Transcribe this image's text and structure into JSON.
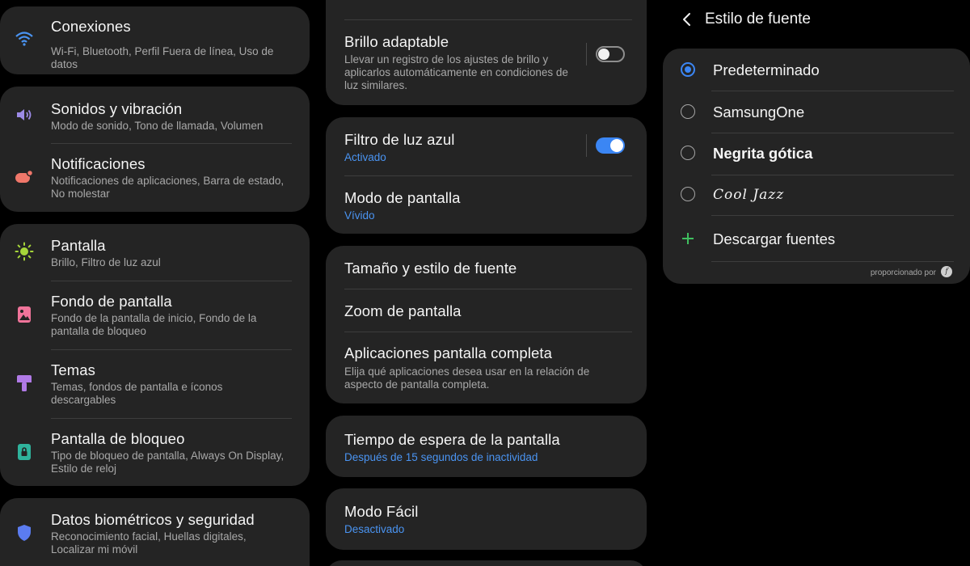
{
  "panel1": {
    "conexiones": {
      "title": "Conexiones",
      "subtitle": "Wi-Fi, Bluetooth, Perfil Fuera de línea, Uso de datos",
      "icon": "wifi-icon",
      "color": "#4a94f2"
    },
    "sonidos": {
      "title": "Sonidos y vibración",
      "subtitle": "Modo de sonido, Tono de llamada, Volumen",
      "icon": "volume-icon",
      "color": "#9c8ae6"
    },
    "notificaciones": {
      "title": "Notificaciones",
      "subtitle": "Notificaciones de aplicaciones, Barra de estado, No molestar",
      "icon": "notification-icon",
      "color": "#f0776a"
    },
    "pantalla": {
      "title": "Pantalla",
      "subtitle": "Brillo, Filtro de luz azul",
      "icon": "brightness-icon",
      "color": "#a6d63a"
    },
    "fondo": {
      "title": "Fondo de pantalla",
      "subtitle": "Fondo de la pantalla de inicio, Fondo de la pantalla de bloqueo",
      "icon": "wallpaper-icon",
      "color": "#f0749a"
    },
    "temas": {
      "title": "Temas",
      "subtitle": "Temas, fondos de pantalla e íconos descargables",
      "icon": "theme-brush-icon",
      "color": "#b07ae6"
    },
    "bloqueo": {
      "title": "Pantalla de bloqueo",
      "subtitle": "Tipo de bloqueo de pantalla, Always On Display, Estilo de reloj",
      "icon": "lock-icon",
      "color": "#2fb39c"
    },
    "biometricos": {
      "title": "Datos biométricos y seguridad",
      "subtitle": "Reconocimiento facial, Huellas digitales, Localizar mi móvil",
      "icon": "shield-icon",
      "color": "#5b7cf0"
    }
  },
  "panel2": {
    "brillo": {
      "title": "Brillo adaptable",
      "subtitle": "Llevar un registro de los ajustes de brillo y aplicarlos automáticamente en condiciones de luz similares.",
      "toggle": false
    },
    "filtro": {
      "title": "Filtro de luz azul",
      "status": "Activado",
      "toggle": true
    },
    "modo_pantalla": {
      "title": "Modo de pantalla",
      "status": "Vívido"
    },
    "tamano": {
      "title": "Tamaño y estilo de fuente"
    },
    "zoom": {
      "title": "Zoom de pantalla"
    },
    "apps_completa": {
      "title": "Aplicaciones pantalla completa",
      "subtitle": "Elija qué aplicaciones desea usar en la relación de aspecto de pantalla completa."
    },
    "tiempo": {
      "title": "Tiempo de espera de la pantalla",
      "status": "Después de 15 segundos de inactividad"
    },
    "facil": {
      "title": "Modo Fácil",
      "status": "Desactivado"
    },
    "accent": "#4a94f2"
  },
  "panel3": {
    "header": "Estilo de fuente",
    "fonts": [
      {
        "label": "Predeterminado",
        "selected": true
      },
      {
        "label": "SamsungOne",
        "selected": false
      },
      {
        "label": "Negrita gótica",
        "selected": false
      },
      {
        "label": "Cool Jazz",
        "selected": false
      }
    ],
    "download": "Descargar fuentes",
    "powered_by": "proporcionado por",
    "powered_logo": "f",
    "accent": "#3b86f4",
    "plus_color": "#3fbf5f"
  }
}
